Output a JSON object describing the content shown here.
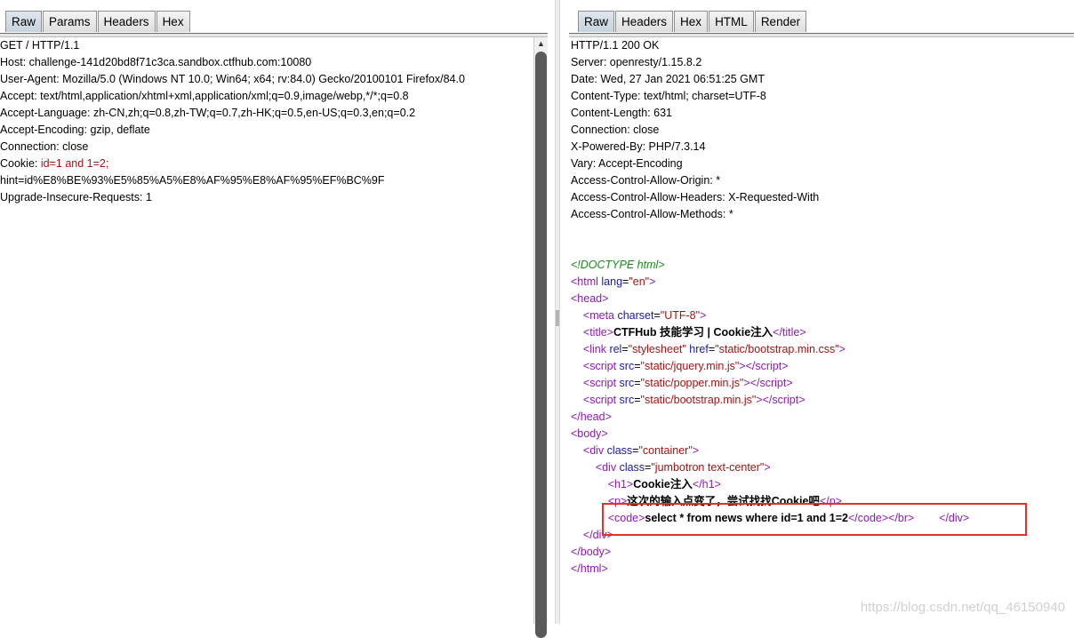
{
  "request": {
    "tabs": [
      "Raw",
      "Params",
      "Headers",
      "Hex"
    ],
    "lines": [
      "GET / HTTP/1.1",
      "Host: challenge-141d20bd8f71c3ca.sandbox.ctfhub.com:10080",
      "User-Agent: Mozilla/5.0 (Windows NT 10.0; Win64; x64; rv:84.0) Gecko/20100101 Firefox/84.0",
      "Accept: text/html,application/xhtml+xml,application/xml;q=0.9,image/webp,*/*;q=0.8",
      "Accept-Language: zh-CN,zh;q=0.8,zh-TW;q=0.7,zh-HK;q=0.5,en-US;q=0.3,en;q=0.2",
      "Accept-Encoding: gzip, deflate",
      "Connection: close"
    ],
    "cookie_label": "Cookie: ",
    "cookie_value": "id=1 and 1=2",
    "cookie_sep": ";",
    "hint_line": "hint=id%E8%BE%93%E5%85%A5%E8%AF%95%E8%AF%95%EF%BC%9F",
    "upgrade_line": "Upgrade-Insecure-Requests: 1"
  },
  "response": {
    "tabs": [
      "Raw",
      "Headers",
      "Hex",
      "HTML",
      "Render"
    ],
    "headers": [
      "HTTP/1.1 200 OK",
      "Server: openresty/1.15.8.2",
      "Date: Wed, 27 Jan 2021 06:51:25 GMT",
      "Content-Type: text/html; charset=UTF-8",
      "Content-Length: 631",
      "Connection: close",
      "X-Powered-By: PHP/7.3.14",
      "Vary: Accept-Encoding",
      "Access-Control-Allow-Origin: *",
      "Access-Control-Allow-Headers: X-Requested-With",
      "Access-Control-Allow-Methods: *"
    ],
    "doctype": "<!DOCTYPE html>",
    "title_text": "CTFHub 技能学习 | Cookie注入",
    "h1_text": "Cookie注入",
    "p_text": "这次的输入点变了，尝试找找Cookie吧",
    "code_text": "select * from news where id=1 and 1=2"
  },
  "watermark": "https://blog.csdn.net/qq_46150940",
  "colors": {
    "highlight": "#e0322d",
    "tag": "#8b1cae",
    "attr": "#1a1aa8",
    "value": "#a01515",
    "comment": "#1b8a1b"
  }
}
